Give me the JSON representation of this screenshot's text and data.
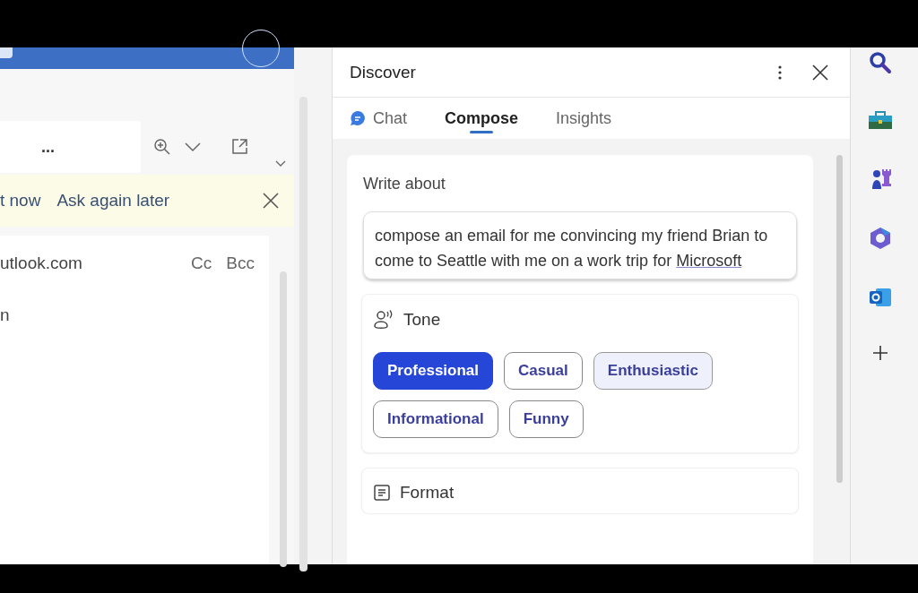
{
  "mail": {
    "more_label": "...",
    "banner": {
      "partial_link": "t now",
      "link": "Ask again later"
    },
    "to_value": "utlook.com",
    "cc": "Cc",
    "bcc": "Bcc",
    "line_2": "n"
  },
  "panel": {
    "title": "Discover",
    "tabs": [
      {
        "label": "Chat",
        "selected": false,
        "kind": "icon"
      },
      {
        "label": "Compose",
        "selected": true,
        "kind": "text"
      },
      {
        "label": "Insights",
        "selected": false,
        "kind": "text"
      }
    ],
    "write_about": {
      "label": "Write about",
      "value": "compose an email for me convincing my friend Brian to come to Seattle with me on a work trip for ",
      "underlined": "Microsoft"
    },
    "tone": {
      "label": "Tone",
      "options": [
        {
          "label": "Professional",
          "selected": true,
          "hovered": false
        },
        {
          "label": "Casual",
          "selected": false,
          "hovered": false
        },
        {
          "label": "Enthusiastic",
          "selected": false,
          "hovered": true
        },
        {
          "label": "Informational",
          "selected": false,
          "hovered": false
        },
        {
          "label": "Funny",
          "selected": false,
          "hovered": false
        }
      ]
    },
    "format": {
      "label": "Format"
    }
  },
  "rail": [
    {
      "kind": "search"
    },
    {
      "kind": "toolbox"
    },
    {
      "kind": "chess"
    },
    {
      "kind": "ring"
    },
    {
      "kind": "mail"
    },
    {
      "kind": "plus"
    }
  ]
}
